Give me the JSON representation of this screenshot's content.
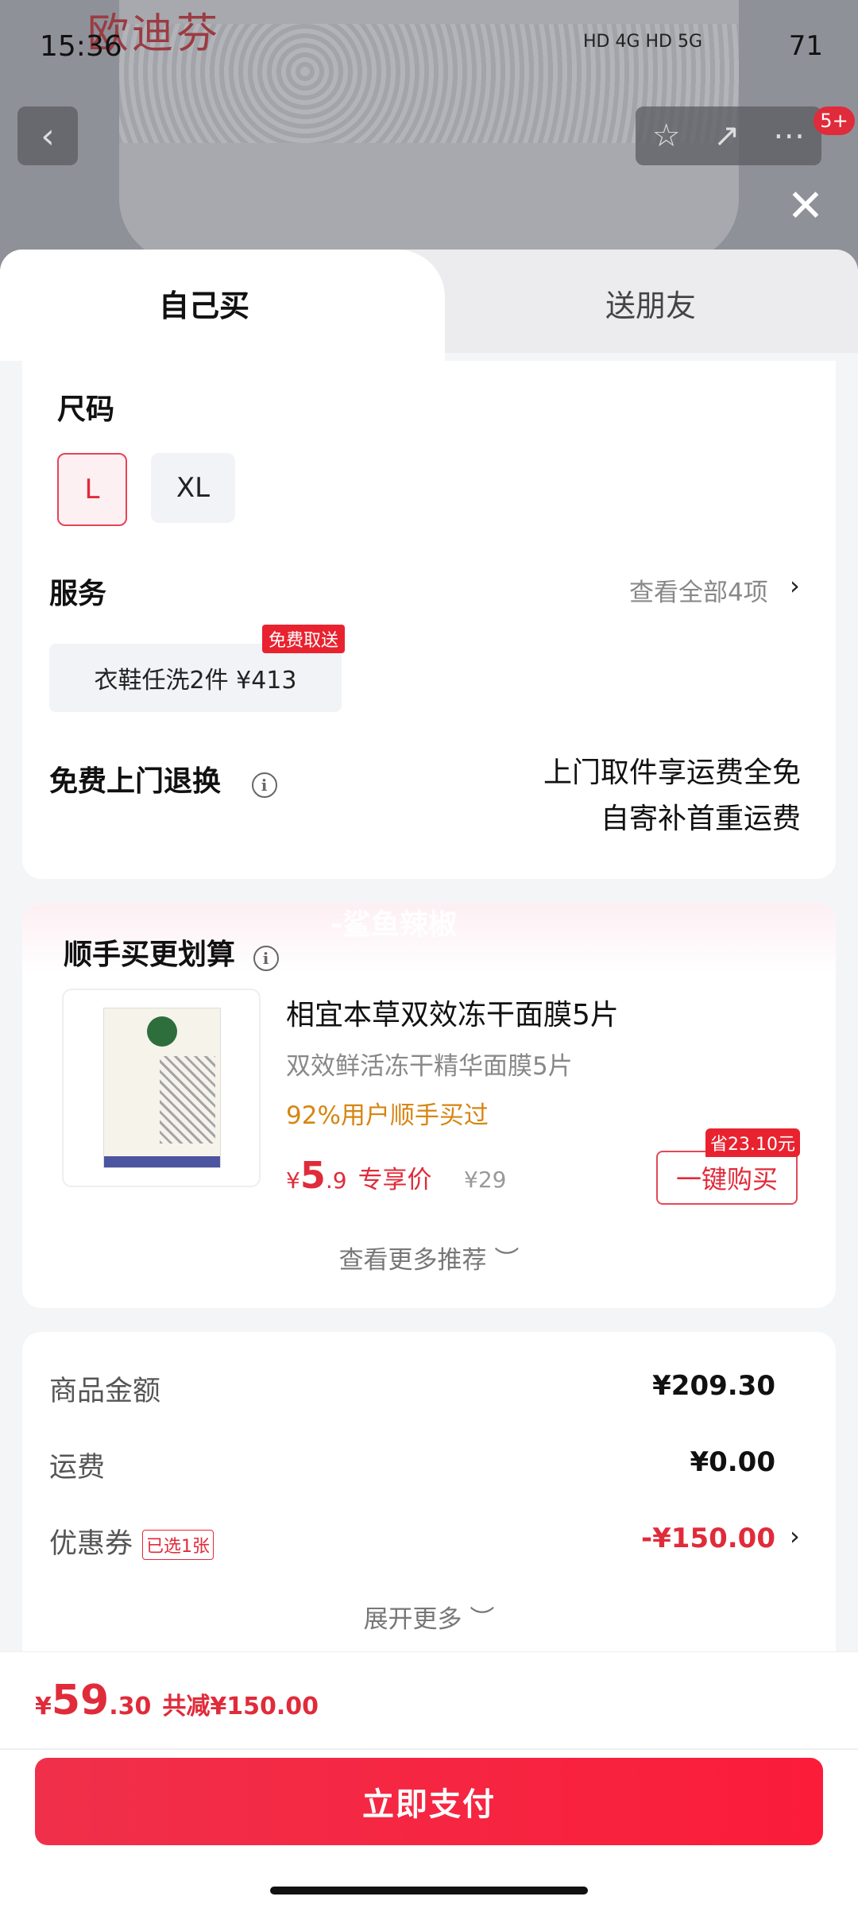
{
  "status": {
    "time": "15:36",
    "network": "HD 4G  HD 5G",
    "battery": "71"
  },
  "background": {
    "brand": "欧迪芬",
    "badge": "5+"
  },
  "tabs": {
    "self": "自己买",
    "gift": "送朋友"
  },
  "size": {
    "title": "尺码",
    "options": [
      "L",
      "XL"
    ],
    "selected": "L"
  },
  "service": {
    "title": "服务",
    "view_all": "查看全部4项",
    "item": "衣鞋任洗2件  ¥413",
    "tag": "免费取送"
  },
  "returns": {
    "title": "免费上门退换",
    "line1": "上门取件享运费全免",
    "line2": "自寄补首重运费"
  },
  "recommend": {
    "title": "顺手买更划算",
    "watermark": "-鲨鱼辣椒",
    "product_title": "相宜本草双效冻干面膜5片",
    "product_sub": "双效鲜活冻干精华面膜5片",
    "social": "92%用户顺手买过",
    "price_cur": "¥",
    "price_int": "5",
    "price_dec": ".9",
    "price_label": "专享价",
    "price_orig": "¥29",
    "save_tag": "省23.10元",
    "buy_label": "一键购买",
    "more": "查看更多推荐 ︶"
  },
  "summary": {
    "goods_label": "商品金额",
    "goods_value": "¥209.30",
    "ship_label": "运费",
    "ship_value": "¥0.00",
    "coupon_label": "优惠券",
    "coupon_tag": "已选1张",
    "coupon_value": "-¥150.00",
    "expand": "展开更多 ︶"
  },
  "footer": {
    "total_cur": "¥",
    "total_int": "59",
    "total_dec": ".30",
    "discount": "共减¥150.00",
    "pay_label": "立即支付"
  },
  "colors": {
    "accent": "#e02b3a",
    "orange": "#d68612"
  }
}
